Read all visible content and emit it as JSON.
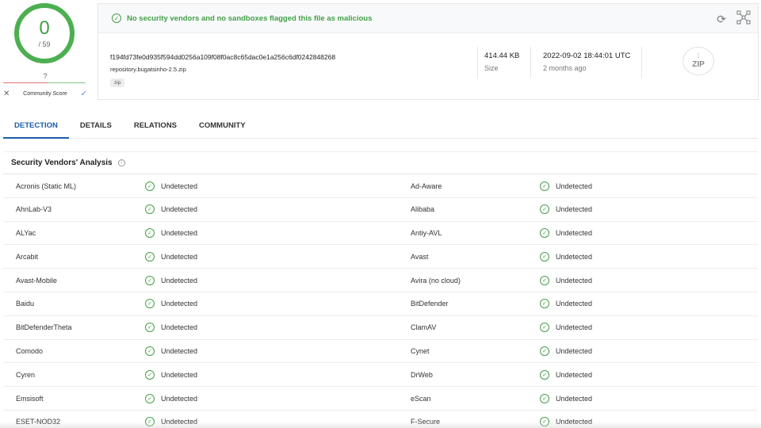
{
  "score": {
    "detections": "0",
    "total": "/ 59"
  },
  "community": {
    "value": "?",
    "label": "Community Score",
    "dislike_icon": "x-icon",
    "like_icon": "check-icon"
  },
  "banner": {
    "message": "No security vendors and no sandboxes flagged this file as malicious",
    "icon": "check-circle-icon"
  },
  "file": {
    "hash": "f194fd73fe0d935f594dd0256a109f08f0ac8c65dac0e1a256c6df0242848268",
    "name": "repository.bugatsinho-2.5.zip",
    "tag": "zip",
    "size_value": "414.44 KB",
    "size_label": "Size",
    "date_value": "2022-09-02 18:44:01 UTC",
    "date_relative": "2 months ago",
    "type_icon_text": "ZIP"
  },
  "tabs": [
    {
      "label": "DETECTION"
    },
    {
      "label": "DETAILS"
    },
    {
      "label": "RELATIONS"
    },
    {
      "label": "COMMUNITY"
    }
  ],
  "section": {
    "title": "Security Vendors' Analysis"
  },
  "vendors": [
    {
      "left": "Acronis (Static ML)",
      "left_result": "Undetected",
      "right": "Ad-Aware",
      "right_result": "Undetected"
    },
    {
      "left": "AhnLab-V3",
      "left_result": "Undetected",
      "right": "Alibaba",
      "right_result": "Undetected"
    },
    {
      "left": "ALYac",
      "left_result": "Undetected",
      "right": "Antiy-AVL",
      "right_result": "Undetected"
    },
    {
      "left": "Arcabit",
      "left_result": "Undetected",
      "right": "Avast",
      "right_result": "Undetected"
    },
    {
      "left": "Avast-Mobile",
      "left_result": "Undetected",
      "right": "Avira (no cloud)",
      "right_result": "Undetected"
    },
    {
      "left": "Baidu",
      "left_result": "Undetected",
      "right": "BitDefender",
      "right_result": "Undetected"
    },
    {
      "left": "BitDefenderTheta",
      "left_result": "Undetected",
      "right": "ClamAV",
      "right_result": "Undetected"
    },
    {
      "left": "Comodo",
      "left_result": "Undetected",
      "right": "Cynet",
      "right_result": "Undetected"
    },
    {
      "left": "Cyren",
      "left_result": "Undetected",
      "right": "DrWeb",
      "right_result": "Undetected"
    },
    {
      "left": "Emsisoft",
      "left_result": "Undetected",
      "right": "eScan",
      "right_result": "Undetected"
    },
    {
      "left": "ESET-NOD32",
      "left_result": "Undetected",
      "right": "F-Secure",
      "right_result": "Undetected"
    }
  ],
  "colors": {
    "clean": "#43a047",
    "accent": "#1b5ea8",
    "ring": "#4caf50"
  }
}
